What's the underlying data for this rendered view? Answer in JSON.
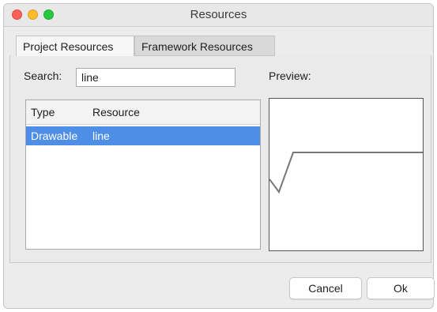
{
  "window": {
    "title": "Resources",
    "controls": [
      "close",
      "minimize",
      "maximize"
    ]
  },
  "tabs": [
    {
      "label": "Project Resources",
      "active": true
    },
    {
      "label": "Framework Resources",
      "active": false
    }
  ],
  "search": {
    "label": "Search:",
    "value": "line"
  },
  "preview": {
    "label": "Preview:",
    "icon": "line-drawable-preview",
    "stroke_color": "#777777"
  },
  "table": {
    "columns": [
      "Type",
      "Resource"
    ],
    "rows": [
      {
        "type": "Drawable",
        "resource": "line",
        "selected": true
      }
    ],
    "selection_color": "#4f8ee6"
  },
  "buttons": {
    "cancel": "Cancel",
    "ok": "Ok"
  }
}
